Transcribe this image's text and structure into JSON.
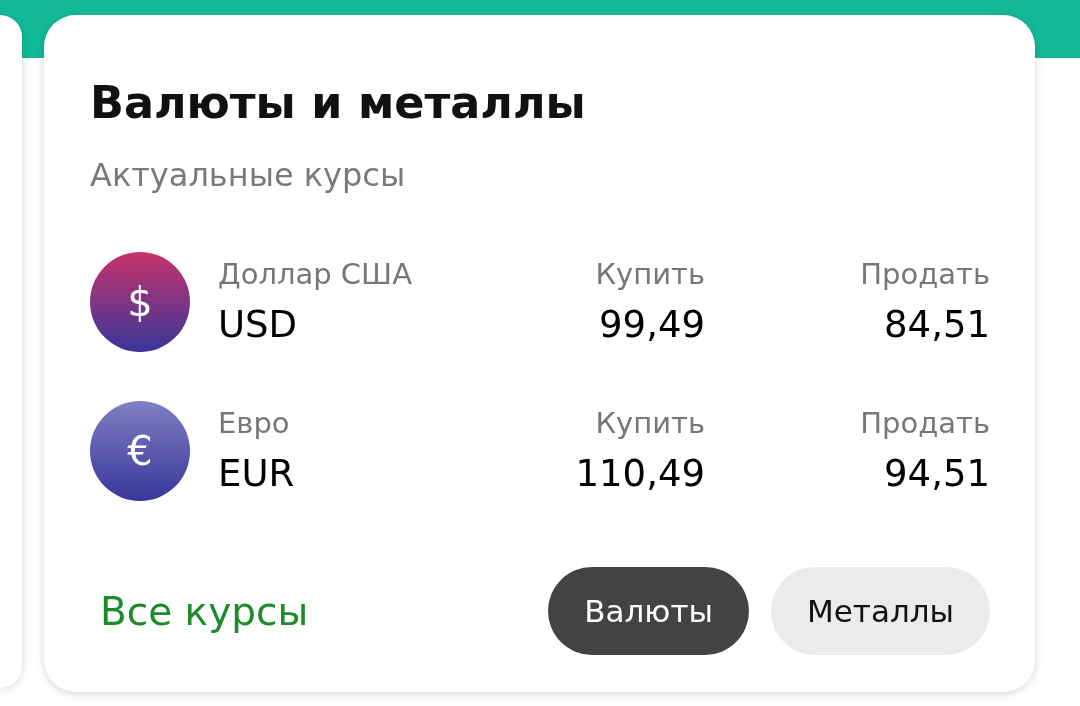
{
  "title": "Валюты и металлы",
  "subtitle": "Актуальные курсы",
  "rates": [
    {
      "kind": "usd",
      "symbol": "$",
      "name": "Доллар США",
      "code": "USD",
      "buy_label": "Купить",
      "buy": "99,49",
      "sell_label": "Продать",
      "sell": "84,51"
    },
    {
      "kind": "eur",
      "symbol": "€",
      "name": "Евро",
      "code": "EUR",
      "buy_label": "Купить",
      "buy": "110,49",
      "sell_label": "Продать",
      "sell": "94,51"
    }
  ],
  "all_rates_link": "Все курсы",
  "tabs": [
    {
      "label": "Валюты",
      "selected": true
    },
    {
      "label": "Металлы",
      "selected": false
    }
  ]
}
